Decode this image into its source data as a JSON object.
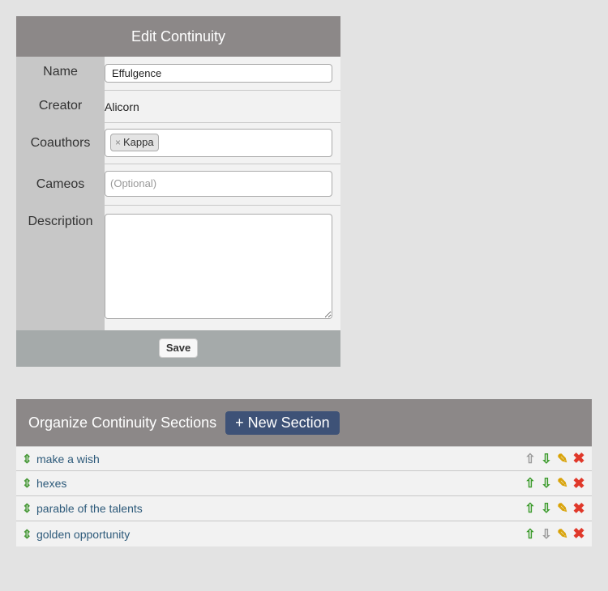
{
  "edit_panel": {
    "title": "Edit Continuity",
    "fields": {
      "name_label": "Name",
      "name_value": "Effulgence",
      "creator_label": "Creator",
      "creator_value": "Alicorn",
      "coauthors_label": "Coauthors",
      "coauthor_tag_remove": "×",
      "coauthor_tags": [
        "Kappa"
      ],
      "cameos_label": "Cameos",
      "cameos_placeholder": "(Optional)",
      "description_label": "Description",
      "description_value": ""
    },
    "save_label": "Save"
  },
  "sections_panel": {
    "title": "Organize Continuity Sections",
    "new_section_label": "+ New Section",
    "icons": {
      "drag": "⇕",
      "up": "⇧",
      "down": "⇩",
      "edit": "✎",
      "delete": "✖"
    },
    "sections": [
      {
        "name": "make a wish",
        "can_move_up": false,
        "can_move_down": true
      },
      {
        "name": "hexes",
        "can_move_up": true,
        "can_move_down": true
      },
      {
        "name": "parable of the talents",
        "can_move_up": true,
        "can_move_down": true
      },
      {
        "name": "golden opportunity",
        "can_move_up": true,
        "can_move_down": false
      }
    ]
  }
}
